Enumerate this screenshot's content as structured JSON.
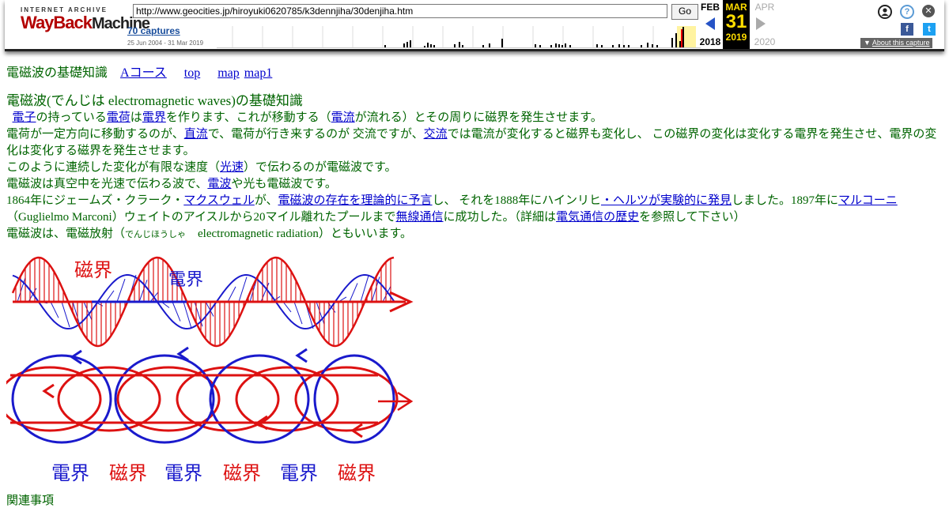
{
  "wayback": {
    "logo_top": "INTERNET ARCHIVE",
    "logo_wayback": "WayBack",
    "logo_machine": "Machine",
    "url": "http://www.geocities.jp/hiroyuki0620785/k3dennjiha/30denjiha.htm",
    "go_label": "Go",
    "captures": "70 captures",
    "range": "25 Jun 2004 - 31 Mar 2019",
    "prev_month": "FEB",
    "prev_year": "2018",
    "cur_month": "MAR",
    "cur_day": "31",
    "cur_year": "2019",
    "next_month": "APR",
    "next_year": "2020",
    "about": "About this capture",
    "login_icon": "user-icon",
    "help_label": "?",
    "close_label": "✕",
    "fb_label": "f",
    "tw_label": "t",
    "sparkline": [
      0,
      0,
      0,
      0,
      0,
      0,
      0,
      0,
      0,
      0,
      0,
      0,
      0,
      0,
      0,
      0,
      0,
      0,
      0,
      0,
      0,
      0,
      0,
      0,
      0,
      0,
      0,
      0,
      0,
      0,
      0,
      0,
      0,
      0,
      0,
      0,
      0,
      0,
      0,
      0,
      0,
      0,
      0,
      0,
      0,
      0,
      0,
      0,
      0,
      0,
      0,
      0,
      0,
      0,
      0,
      0,
      0,
      0,
      0,
      0,
      0,
      0,
      0,
      0,
      0,
      0,
      0,
      0,
      0,
      0,
      0,
      0,
      0,
      0,
      0,
      0,
      0,
      0,
      0,
      0,
      0,
      0,
      0,
      0,
      0,
      0,
      0,
      0,
      0,
      0,
      0,
      0,
      0,
      0,
      0,
      0,
      0,
      0,
      0,
      0,
      0,
      0,
      0,
      0,
      0,
      0,
      0,
      0,
      0,
      0,
      0,
      0,
      0,
      0,
      0,
      0,
      0,
      0,
      0,
      0,
      0,
      0,
      0,
      0,
      0,
      0,
      0,
      0,
      0,
      0,
      0,
      0,
      0,
      0,
      0,
      0,
      0,
      0,
      0,
      0,
      0,
      0,
      0,
      0,
      0,
      0,
      0,
      0,
      0,
      0,
      0,
      0,
      0,
      0,
      0,
      0,
      0,
      0,
      0,
      0,
      0,
      0,
      0,
      0,
      0,
      0,
      0,
      0,
      0,
      0,
      0,
      0,
      0,
      0,
      0,
      0,
      0,
      0,
      0,
      0,
      0,
      0,
      0,
      0,
      0,
      0,
      0,
      0,
      0,
      0,
      0,
      0,
      0,
      0,
      0,
      0,
      0,
      0,
      0,
      0,
      0,
      0,
      0,
      0,
      0,
      0,
      0,
      0,
      0,
      0,
      0,
      0,
      0,
      0,
      0,
      0,
      0,
      0,
      0,
      0,
      0,
      0,
      0,
      0,
      0,
      0,
      0,
      0,
      0,
      0,
      0,
      0,
      0,
      0,
      0,
      0,
      0,
      0,
      0,
      0,
      0,
      0,
      0,
      0,
      0,
      0,
      0,
      0,
      0,
      0,
      0,
      0,
      0,
      0,
      0,
      0,
      0,
      0,
      0,
      0,
      0,
      0,
      0,
      0,
      0,
      0,
      0,
      0,
      0,
      0,
      0,
      0,
      0,
      0,
      0,
      0,
      0,
      0,
      0,
      0,
      0,
      0,
      0,
      0,
      0,
      0,
      0,
      0,
      0,
      0,
      0,
      0,
      0,
      0,
      0,
      0,
      0,
      0,
      0,
      0,
      0,
      0,
      0,
      0,
      0,
      0,
      0,
      0,
      0,
      0,
      0,
      0,
      0,
      0,
      0,
      0,
      0,
      0,
      0,
      0,
      0,
      0,
      0,
      0,
      0,
      0,
      0,
      0,
      0,
      0,
      0,
      0,
      0,
      0,
      0,
      0,
      0,
      0,
      0,
      0,
      0,
      0,
      0,
      0,
      0,
      0,
      0,
      0,
      0,
      0,
      0,
      0,
      0,
      0,
      0,
      0,
      0,
      0,
      0,
      0,
      0,
      0,
      0,
      0,
      0,
      0,
      0,
      0,
      0,
      0,
      0,
      0,
      0,
      0,
      0,
      0,
      0,
      0,
      0,
      0,
      0,
      0,
      0,
      0,
      0,
      0,
      0,
      0,
      0,
      0,
      0,
      0,
      0,
      0,
      0,
      0,
      0,
      0,
      0,
      0,
      0,
      0,
      0,
      0,
      0,
      0,
      0,
      0,
      0,
      0,
      0,
      0,
      0,
      0,
      0,
      0,
      0,
      0,
      0,
      0,
      0,
      0,
      0,
      0,
      0,
      0,
      0,
      0,
      0,
      0,
      0,
      0,
      0,
      0,
      0,
      0,
      0,
      0,
      0,
      0,
      0,
      0,
      0,
      0,
      0,
      0,
      0,
      0,
      0,
      0,
      0,
      0,
      0,
      0,
      0,
      0,
      0,
      0,
      0,
      0,
      0,
      0,
      0,
      0,
      0,
      0,
      0,
      0,
      0,
      0,
      0,
      0,
      0,
      0,
      0,
      0,
      0,
      0,
      0,
      0,
      0,
      0,
      0,
      0,
      0,
      0,
      0,
      0,
      0,
      0,
      0,
      0,
      0,
      0,
      0,
      0,
      0,
      0,
      0,
      0,
      0,
      0,
      0,
      0,
      0,
      0,
      0,
      0,
      0,
      0,
      0,
      0,
      0,
      0,
      0,
      0,
      0,
      0,
      0,
      0,
      0,
      0,
      0,
      0,
      0,
      0,
      0,
      0,
      0,
      0,
      0,
      0,
      0,
      0,
      0,
      0,
      0,
      0,
      0,
      0,
      0,
      0,
      0,
      0,
      0,
      0,
      0,
      0,
      0,
      0,
      0,
      0,
      0,
      0,
      0,
      0,
      0,
      0,
      0,
      0,
      0,
      0,
      0,
      0,
      0,
      0,
      0,
      0,
      0,
      0,
      0,
      0,
      0,
      0,
      0,
      0,
      0,
      0,
      0,
      0,
      0,
      0,
      0,
      0,
      0,
      0,
      0,
      0,
      0,
      0,
      0,
      0,
      0,
      0,
      0,
      0,
      0,
      0,
      0,
      0,
      0,
      0,
      0,
      0,
      0,
      0,
      0,
      0,
      0,
      0,
      0,
      0,
      0,
      0,
      0,
      0,
      0,
      0,
      0,
      0,
      0,
      0,
      0,
      0,
      0,
      0,
      0,
      0,
      0,
      0,
      0,
      0,
      0,
      0,
      0,
      0,
      0,
      0,
      0,
      0,
      0,
      0,
      0,
      0,
      0,
      0,
      0,
      0,
      0,
      0,
      0,
      0,
      0,
      0,
      0,
      0,
      0,
      0,
      0,
      0,
      0,
      0,
      0,
      0,
      0,
      0,
      0,
      0,
      0,
      0,
      0,
      0,
      0,
      0,
      0,
      0,
      0,
      0,
      0,
      0,
      0,
      0,
      0,
      0,
      0,
      0,
      0,
      0,
      0,
      0,
      0,
      0,
      0,
      0,
      0,
      0,
      0,
      0,
      0,
      0,
      0,
      0,
      0,
      0,
      0,
      0,
      0,
      0,
      0,
      0,
      0,
      0,
      0,
      0,
      0,
      0,
      0,
      0,
      0
    ]
  },
  "nav": {
    "site_title": "電磁波の基礎知識",
    "link_a": "Aコース",
    "link_top": "top",
    "link_map": "map",
    "link_map1": "map1"
  },
  "article": {
    "heading": "電磁波(でんじは electromagnetic waves)の基礎知識",
    "p1": {
      "link_denshi": "電子",
      "t1": "の持っている",
      "link_denka": "電荷",
      "t2": "は",
      "link_denkai": "電界",
      "t3": "を作ります、これが移動する（",
      "link_denryu": "電流",
      "t4": "が流れる）とその周りに磁界を発生させます。"
    },
    "p2": {
      "t1": "電荷が一定方向に移動するのが、",
      "link_chokuryu": "直流",
      "t2": "で、電荷が行き来するのが 交流ですが、",
      "link_koryu": "交流",
      "t3": "では電流が変化すると磁界も変化し、 この磁界の変化は変化する電界を発生させ、電界の変化は変化する磁界を発生させます。"
    },
    "p3": {
      "t1": "このように連続した変化が有限な速度（",
      "link_kousoku": "光速",
      "t2": "）で伝わるのが電磁波です。"
    },
    "p4": {
      "t1": "電磁波は真空中を光速で伝わる波で、",
      "link_denpa": "電波",
      "t2": "や光も電磁波です。"
    },
    "p5": {
      "t1": "1864年にジェームズ・クラーク・",
      "link_maxwell": "マクスウェル",
      "t2": "が、",
      "link_yogen": "電磁波の存在を理論的に予言",
      "t3": "し、 それを1888年にハインリヒ",
      "link_hertz": "・ヘルツが実験的に発見",
      "t4": "しました。1897年に",
      "link_marconi": "マルコーニ",
      "t5": "（Guglielmo Marconi）ウェイトのアイスルから20マイル離れたプールまで",
      "link_musen": "無線通信",
      "t6": "に成功した。（詳細は",
      "link_rekishi": "電気通信の歴史",
      "t7": "を参照して下さい）"
    },
    "p6": {
      "t1": "電磁波は、電磁放射（",
      "ruby": "でんじほうしゃ",
      "t2": "　electromagnetic radiation）ともいいます。"
    }
  },
  "figure": {
    "label_magnetic_top": "磁界",
    "label_electric_top": "電界",
    "bottom_labels": [
      "電界",
      "磁界",
      "電界",
      "磁界",
      "電界",
      "磁界"
    ],
    "color_electric": "#1a1acc",
    "color_magnetic": "#dd1111"
  },
  "related": {
    "label": "関連事項"
  }
}
